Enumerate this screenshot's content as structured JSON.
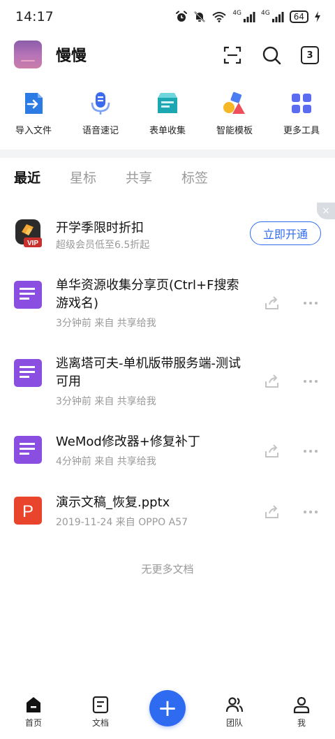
{
  "status_bar": {
    "time": "14:17",
    "signal1_label": "4G",
    "signal2_label": "4G",
    "battery": "64"
  },
  "header": {
    "username": "慢慢",
    "count": "3"
  },
  "tools": [
    {
      "label": "导入文件",
      "icon": "import-file-icon"
    },
    {
      "label": "语音速记",
      "icon": "microphone-icon"
    },
    {
      "label": "表单收集",
      "icon": "form-collect-icon"
    },
    {
      "label": "智能模板",
      "icon": "smart-template-icon"
    },
    {
      "label": "更多工具",
      "icon": "grid-tools-icon"
    }
  ],
  "tabs": [
    {
      "label": "最近",
      "active": true
    },
    {
      "label": "星标",
      "active": false
    },
    {
      "label": "共享",
      "active": false
    },
    {
      "label": "标签",
      "active": false
    }
  ],
  "promo": {
    "title": "开学季限时折扣",
    "subtitle": "超级会员低至6.5折起",
    "button": "立即开通",
    "badge": "VIP",
    "close": "×"
  },
  "documents": [
    {
      "title": "单华资源收集分享页(Ctrl+F搜索游戏名)",
      "meta": "3分钟前  来自 共享给我",
      "type": "doc"
    },
    {
      "title": "逃离塔可夫-单机版带服务端-测试可用",
      "meta": "3分钟前  来自 共享给我",
      "type": "doc"
    },
    {
      "title": "WeMod修改器+修复补丁",
      "meta": "4分钟前  来自 共享给我",
      "type": "doc"
    },
    {
      "title": "演示文稿_恢复.pptx",
      "meta": "2019-11-24  来自 OPPO A57",
      "type": "ppt",
      "letter": "P"
    }
  ],
  "no_more": "无更多文档",
  "bottom_nav": {
    "home": "首页",
    "docs": "文档",
    "fab": "+",
    "team": "团队",
    "me": "我"
  },
  "colors": {
    "accent": "#2f6bf1",
    "doc_purple": "#8a4fe0",
    "ppt_red": "#e8452c"
  }
}
